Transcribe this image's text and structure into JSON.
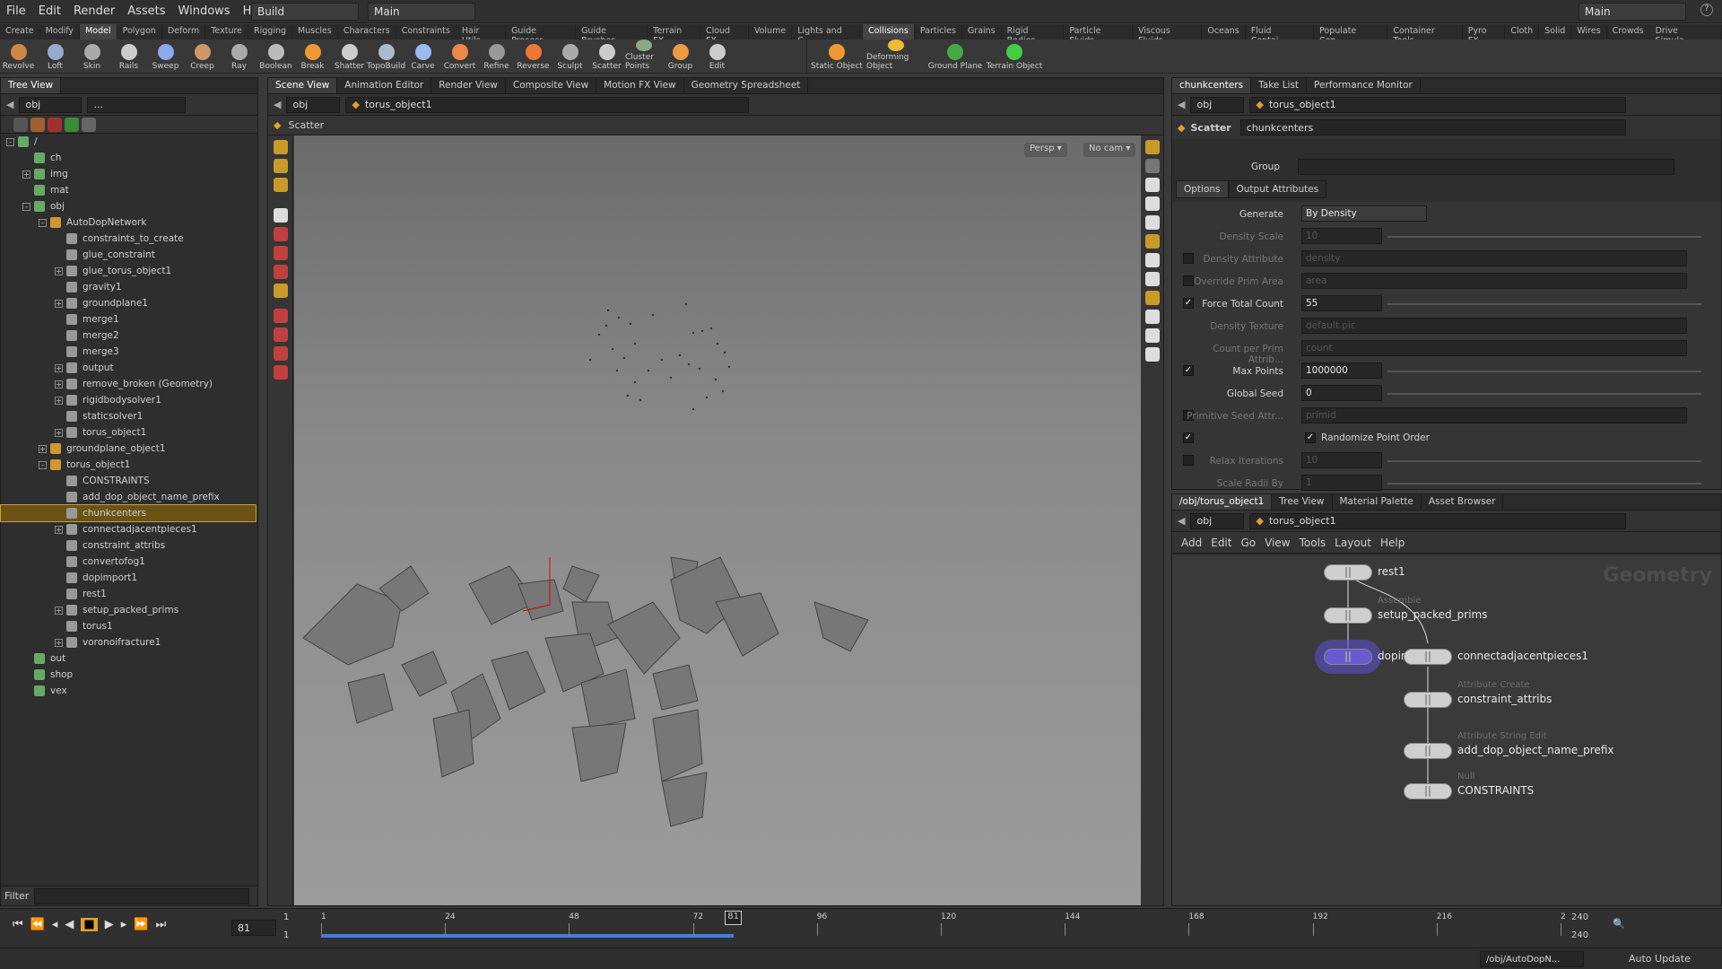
{
  "menu": [
    "File",
    "Edit",
    "Render",
    "Assets",
    "Windows",
    "Help"
  ],
  "desktop": {
    "build": "Build",
    "main": "Main",
    "right": "Main"
  },
  "shelf_tabs": [
    "Create",
    "Modify",
    "Model",
    "Polygon",
    "Deform",
    "Texture",
    "Rigging",
    "Muscles",
    "Characters",
    "Constraints",
    "Hair Utils",
    "Guide Process",
    "Guide Brushes",
    "Terrain FX",
    "Cloud FX",
    "Volume"
  ],
  "shelf_tabs_right": [
    "Lights and C...",
    "Collisions",
    "Particles",
    "Grains",
    "Rigid Bodies",
    "Particle Fluids",
    "Viscous Fluids",
    "Oceans",
    "Fluid Contai...",
    "Populate Con...",
    "Container Tools",
    "Pyro FX",
    "Cloth",
    "Solid",
    "Wires",
    "Crowds",
    "Drive Simula..."
  ],
  "tools": [
    "Revolve",
    "Loft",
    "Skin",
    "Rails",
    "Sweep",
    "Creep",
    "Ray",
    "Boolean",
    "Break",
    "Shatter",
    "TopoBuild",
    "Carve",
    "Convert",
    "Refine",
    "Reverse",
    "Sculpt",
    "Scatter",
    "Cluster Points",
    "Group",
    "Edit"
  ],
  "tools_right": [
    "Static Object",
    "Deforming Object",
    "Ground Plane",
    "Terrain Object"
  ],
  "left": {
    "tab": "Tree View",
    "path": "obj",
    "path2": "...",
    "filter_label": "Filter",
    "tree": [
      {
        "label": "/",
        "depth": 0,
        "exp": "-"
      },
      {
        "label": "ch",
        "depth": 1,
        "exp": ""
      },
      {
        "label": "img",
        "depth": 1,
        "exp": "+"
      },
      {
        "label": "mat",
        "depth": 1,
        "exp": ""
      },
      {
        "label": "obj",
        "depth": 1,
        "exp": "-"
      },
      {
        "label": "AutoDopNetwork",
        "depth": 2,
        "exp": "-"
      },
      {
        "label": "constraints_to_create",
        "depth": 3,
        "exp": ""
      },
      {
        "label": "glue_constraint",
        "depth": 3,
        "exp": ""
      },
      {
        "label": "glue_torus_object1",
        "depth": 3,
        "exp": "+"
      },
      {
        "label": "gravity1",
        "depth": 3,
        "exp": ""
      },
      {
        "label": "groundplane1",
        "depth": 3,
        "exp": "+"
      },
      {
        "label": "merge1",
        "depth": 3,
        "exp": ""
      },
      {
        "label": "merge2",
        "depth": 3,
        "exp": ""
      },
      {
        "label": "merge3",
        "depth": 3,
        "exp": ""
      },
      {
        "label": "output",
        "depth": 3,
        "exp": "+"
      },
      {
        "label": "remove_broken (Geometry)",
        "depth": 3,
        "exp": "+"
      },
      {
        "label": "rigidbodysolver1",
        "depth": 3,
        "exp": "+"
      },
      {
        "label": "staticsolver1",
        "depth": 3,
        "exp": ""
      },
      {
        "label": "torus_object1",
        "depth": 3,
        "exp": "+"
      },
      {
        "label": "groundplane_object1",
        "depth": 2,
        "exp": "+"
      },
      {
        "label": "torus_object1",
        "depth": 2,
        "exp": "-"
      },
      {
        "label": "CONSTRAINTS",
        "depth": 3,
        "exp": ""
      },
      {
        "label": "add_dop_object_name_prefix",
        "depth": 3,
        "exp": ""
      },
      {
        "label": "chunkcenters",
        "depth": 3,
        "exp": "",
        "sel": true
      },
      {
        "label": "connectadjacentpieces1",
        "depth": 3,
        "exp": "+"
      },
      {
        "label": "constraint_attribs",
        "depth": 3,
        "exp": ""
      },
      {
        "label": "convertofog1",
        "depth": 3,
        "exp": ""
      },
      {
        "label": "dopimport1",
        "depth": 3,
        "exp": ""
      },
      {
        "label": "rest1",
        "depth": 3,
        "exp": ""
      },
      {
        "label": "setup_packed_prims",
        "depth": 3,
        "exp": "+"
      },
      {
        "label": "torus1",
        "depth": 3,
        "exp": ""
      },
      {
        "label": "voronoifracture1",
        "depth": 3,
        "exp": "+"
      },
      {
        "label": "out",
        "depth": 1,
        "exp": ""
      },
      {
        "label": "shop",
        "depth": 1,
        "exp": ""
      },
      {
        "label": "vex",
        "depth": 1,
        "exp": ""
      }
    ]
  },
  "viewer": {
    "tabs": [
      "Scene View",
      "Animation Editor",
      "Render View",
      "Composite View",
      "Motion FX View",
      "Geometry Spreadsheet"
    ],
    "path": "obj",
    "node": "torus_object1",
    "tool": "Scatter",
    "persp": "Persp ▾",
    "cam": "No cam ▾"
  },
  "params": {
    "tabs": [
      "chunkcenters",
      "Take List",
      "Performance Monitor"
    ],
    "path": "obj",
    "node": "torus_object1",
    "type": "Scatter",
    "name": "chunkcenters",
    "group_label": "Group",
    "sub_tabs": [
      "Options",
      "Output Attributes"
    ],
    "rows": [
      {
        "label": "Generate",
        "value": "By Density",
        "dim": false,
        "cb": "",
        "kind": "menu"
      },
      {
        "label": "Density Scale",
        "value": "10",
        "dim": true,
        "cb": "",
        "kind": "slider"
      },
      {
        "label": "Density Attribute",
        "value": "density",
        "dim": true,
        "cb": "off",
        "kind": "text"
      },
      {
        "label": "Override Prim Area",
        "value": "area",
        "dim": true,
        "cb": "off",
        "kind": "text"
      },
      {
        "label": "Force Total Count",
        "value": "55",
        "dim": false,
        "cb": "on",
        "kind": "slider"
      },
      {
        "label": "Density Texture",
        "value": "default.pic",
        "dim": true,
        "cb": "",
        "kind": "text"
      },
      {
        "label": "Count per Prim Attrib...",
        "value": "count",
        "dim": true,
        "cb": "",
        "kind": "text"
      },
      {
        "label": "Max Points",
        "value": "1000000",
        "dim": false,
        "cb": "on",
        "kind": "slider"
      },
      {
        "label": "Global Seed",
        "value": "0",
        "dim": false,
        "cb": "",
        "kind": "slider"
      },
      {
        "label": "Primitive Seed Attr...",
        "value": "primid",
        "dim": true,
        "cb": "off",
        "kind": "text"
      },
      {
        "label": "",
        "value": "Randomize Point Order",
        "dim": false,
        "cb": "on",
        "kind": "toggle"
      },
      {
        "label": "Relax Iterations",
        "value": "10",
        "dim": true,
        "cb": "off",
        "kind": "slider"
      },
      {
        "label": "Scale Radii By",
        "value": "1",
        "dim": true,
        "cb": "",
        "kind": "slider"
      }
    ]
  },
  "network": {
    "tabs": [
      "/obj/torus_object1",
      "Tree View",
      "Material Palette",
      "Asset Browser"
    ],
    "path": "obj",
    "node": "torus_object1",
    "menu": [
      "Add",
      "Edit",
      "Go",
      "View",
      "Tools",
      "Layout",
      "Help"
    ],
    "watermark": "Geometry",
    "nodes": [
      {
        "name": "rest1",
        "sub": ""
      },
      {
        "name": "setup_packed_prims",
        "sub": "Assemble"
      },
      {
        "name": "dopim",
        "sub": ""
      },
      {
        "name": "connectadjacentpieces1",
        "sub": ""
      },
      {
        "name": "constraint_attribs",
        "sub": "Attribute Create"
      },
      {
        "name": "add_dop_object_name_prefix",
        "sub": "Attribute String Edit"
      },
      {
        "name": "CONSTRAINTS",
        "sub": "Null"
      }
    ]
  },
  "timeline": {
    "frame": "81",
    "start": "1",
    "start2": "1",
    "end": "240",
    "end2": "240",
    "ticks": [
      "1",
      "24",
      "48",
      "72",
      "96",
      "120",
      "144",
      "168",
      "192",
      "216",
      "2"
    ],
    "current_fraction": 0.333
  },
  "status": {
    "path": "/obj/AutoDopN...",
    "update": "Auto Update"
  }
}
